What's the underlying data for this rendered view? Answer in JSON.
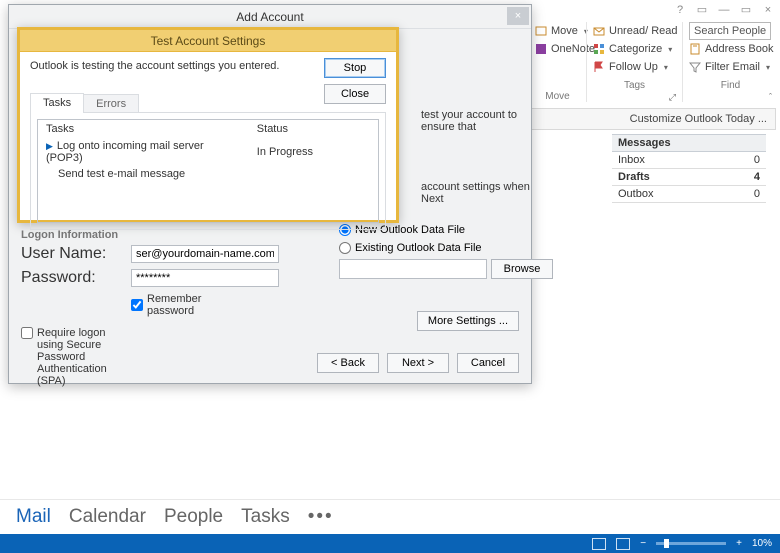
{
  "window": {
    "title_icons": {
      "help": "?",
      "minimize": "—",
      "maximize": "▭",
      "close": "×",
      "ribbon_toggle": "▭"
    }
  },
  "ribbon": {
    "move": {
      "item1": "Move",
      "item2": "OneNote",
      "label": "Move"
    },
    "tags": {
      "unread": "Unread/ Read",
      "categorize": "Categorize",
      "followup": "Follow Up",
      "label": "Tags"
    },
    "find": {
      "search_placeholder": "Search People",
      "addressbook": "Address Book",
      "filter": "Filter Email",
      "label": "Find"
    }
  },
  "customize_row": "Customize Outlook Today ...",
  "messages": {
    "title": "Messages",
    "rows": [
      {
        "name": "Inbox",
        "count": "0",
        "bold": false
      },
      {
        "name": "Drafts",
        "count": "4",
        "bold": true
      },
      {
        "name": "Outbox",
        "count": "0",
        "bold": false
      }
    ]
  },
  "navbar": {
    "mail": "Mail",
    "calendar": "Calendar",
    "people": "People",
    "tasks": "Tasks",
    "more": "•••"
  },
  "statusbar": {
    "zoom": "10%",
    "plus": "+"
  },
  "add_account": {
    "title": "Add Account",
    "hint1": "test your account to ensure that",
    "hint2": "account settings when Next",
    "logon_title": "Logon Information",
    "user_label": "User Name:",
    "user_value": "ser@yourdomain-name.com",
    "pass_label": "Password:",
    "pass_value": "********",
    "remember": "Remember password",
    "spa": "Require logon using Secure Password Authentication (SPA)",
    "radio_new": "New Outlook Data File",
    "radio_existing": "Existing Outlook Data File",
    "browse": "Browse",
    "more": "More Settings ...",
    "back": "< Back",
    "next": "Next >",
    "cancel": "Cancel"
  },
  "test": {
    "title": "Test Account Settings",
    "message": "Outlook is testing the account settings you entered.",
    "stop": "Stop",
    "close": "Close",
    "tab_tasks": "Tasks",
    "tab_errors": "Errors",
    "col_tasks": "Tasks",
    "col_status": "Status",
    "row1_task": "Log onto incoming mail server (POP3)",
    "row1_status": "In Progress",
    "row2_task": "Send test e-mail message",
    "row2_status": ""
  }
}
